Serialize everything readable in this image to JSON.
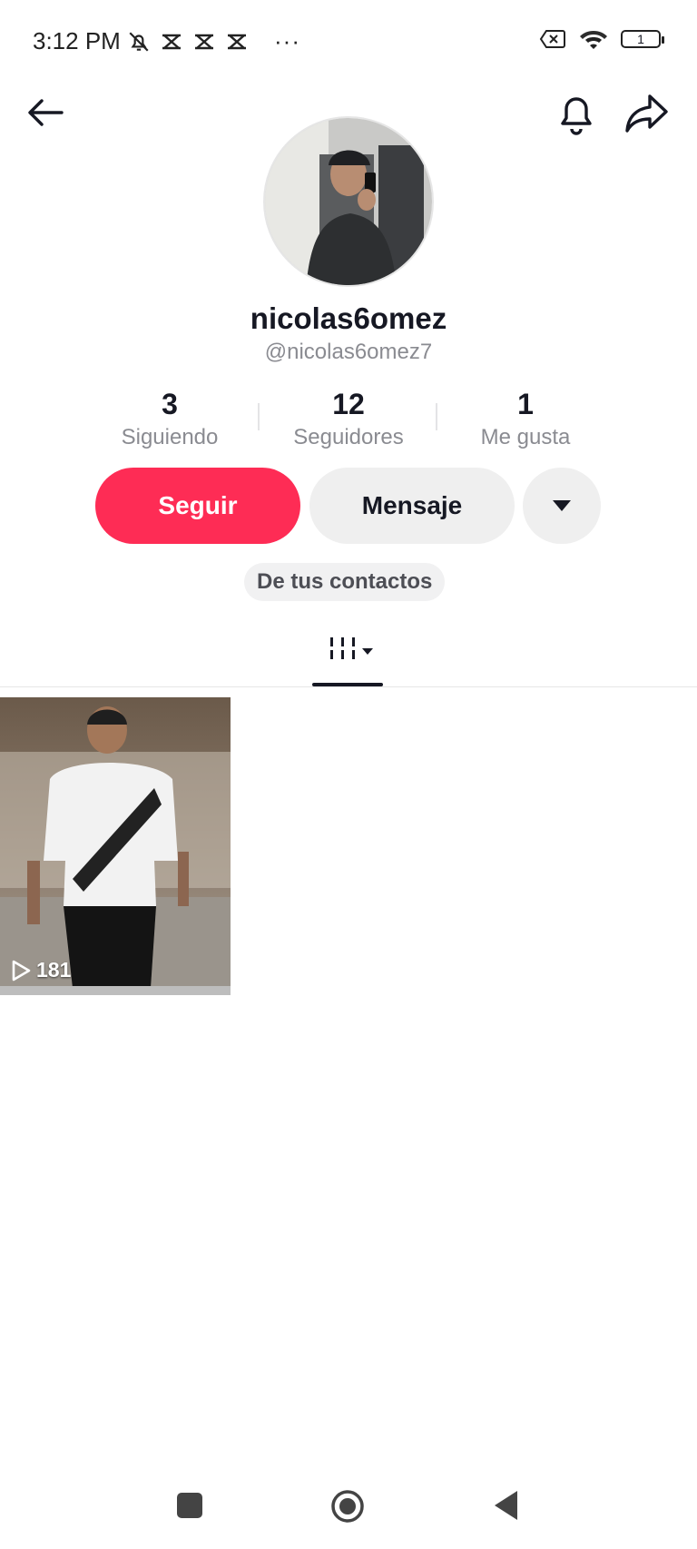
{
  "status_bar": {
    "time": "3:12 PM",
    "more": "···",
    "battery_level": "1",
    "icons_left": [
      "bell-off-icon",
      "capcut-icon",
      "capcut-icon",
      "capcut-icon"
    ],
    "icons_right": [
      "no-sim-icon",
      "wifi-icon",
      "battery-icon"
    ]
  },
  "header": {
    "icons": [
      "back-arrow-icon",
      "bell-icon",
      "share-icon"
    ]
  },
  "profile": {
    "display_name": "nicolas6omez",
    "handle": "@nicolas6omez7"
  },
  "stats": [
    {
      "value": "3",
      "label": "Siguiendo"
    },
    {
      "value": "12",
      "label": "Seguidores"
    },
    {
      "value": "1",
      "label": "Me gusta"
    }
  ],
  "actions": {
    "follow_label": "Seguir",
    "message_label": "Mensaje",
    "more_icon": "caret-down-icon"
  },
  "contacts_chip": "De tus contactos",
  "tabs": {
    "active": "videos-grid-icon"
  },
  "videos": [
    {
      "plays": "181"
    }
  ],
  "colors": {
    "accent": "#fe2c55",
    "secondary_button": "#efefef",
    "text_primary": "#161823",
    "text_secondary": "#8a8b91"
  },
  "nav_bar": {
    "icons": [
      "recents-square-icon",
      "home-circle-icon",
      "back-triangle-icon"
    ]
  }
}
